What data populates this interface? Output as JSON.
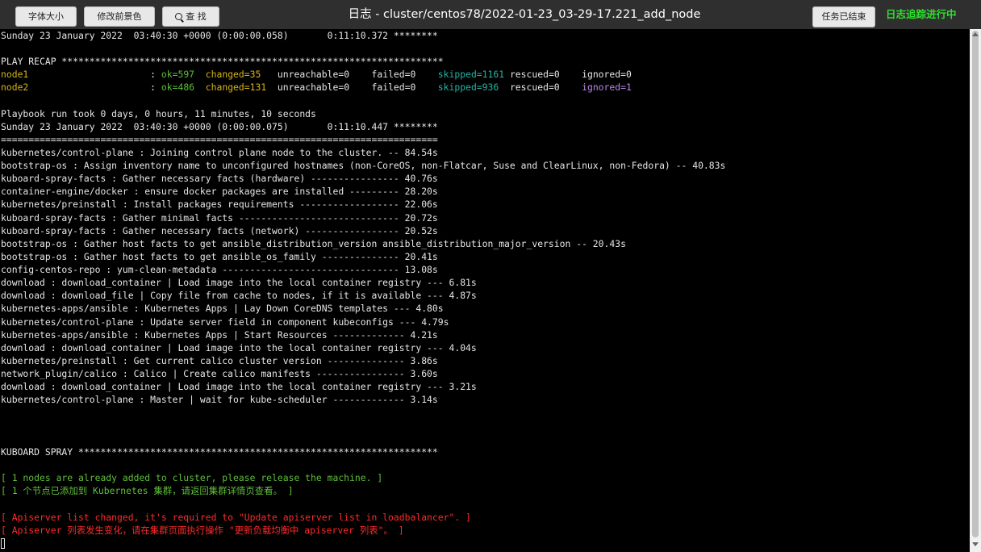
{
  "header": {
    "font_size_label": "字体大小",
    "bg_color_label": "修改前景色",
    "search_label": "查 找",
    "title": "日志 - cluster/centos78/2022-01-23_03-29-17.221_add_node",
    "task_done_label": "任务已结束",
    "tracking_status": "日志追踪进行中"
  },
  "colors": {
    "header_bg": "#2f2f2f",
    "terminal_bg": "#000000",
    "text": "#e6e6e6",
    "ok_yellow": "#d8b417",
    "ok_green": "#5fbf3a",
    "skipped_cyan": "#24b3a6",
    "ignored_magenta": "#b986e6",
    "error_red": "#ff2a2a",
    "tracking_green": "#2fe02f"
  },
  "log": {
    "l01": "Sunday 23 January 2022  03:40:30 +0000 (0:00:00.058)       0:11:10.372 ********",
    "l02": "PLAY RECAP *********************************************************************",
    "recap": {
      "n1_host": "node1                      ",
      "n1_sep": ": ",
      "n1_ok": "ok=597",
      "n1_gap1": "  ",
      "n1_changed": "changed=35",
      "n1_mid": "   unreachable=0    failed=0    ",
      "n1_skipped": "skipped=1161",
      "n1_tail": " rescued=0    ignored=0",
      "n2_host": "node2                      ",
      "n2_sep": ": ",
      "n2_ok": "ok=486",
      "n2_gap1": "  ",
      "n2_changed": "changed=131",
      "n2_mid": "  unreachable=0    failed=0    ",
      "n2_skipped": "skipped=936",
      "n2_gap2": "  rescued=0    ",
      "n2_ignored": "ignored=1"
    },
    "l03": "Playbook run took 0 days, 0 hours, 11 minutes, 10 seconds",
    "l04": "Sunday 23 January 2022  03:40:30 +0000 (0:00:00.075)       0:11:10.447 ********",
    "l05": "===============================================================================",
    "l06": "kubernetes/control-plane : Joining control plane node to the cluster. -- 84.54s",
    "l07": "bootstrap-os : Assign inventory name to unconfigured hostnames (non-CoreOS, non-Flatcar, Suse and ClearLinux, non-Fedora) -- 40.83s",
    "l08": "kuboard-spray-facts : Gather necessary facts (hardware) ---------------- 40.76s",
    "l09": "container-engine/docker : ensure docker packages are installed --------- 28.20s",
    "l10": "kubernetes/preinstall : Install packages requirements ------------------ 22.06s",
    "l11": "kuboard-spray-facts : Gather minimal facts ----------------------------- 20.72s",
    "l12": "kuboard-spray-facts : Gather necessary facts (network) ----------------- 20.52s",
    "l13": "bootstrap-os : Gather host facts to get ansible_distribution_version ansible_distribution_major_version -- 20.43s",
    "l14": "bootstrap-os : Gather host facts to get ansible_os_family -------------- 20.41s",
    "l15": "config-centos-repo : yum-clean-metadata -------------------------------- 13.08s",
    "l16": "download : download_container | Load image into the local container registry --- 6.81s",
    "l17": "download : download_file | Copy file from cache to nodes, if it is available --- 4.87s",
    "l18": "kubernetes-apps/ansible : Kubernetes Apps | Lay Down CoreDNS templates --- 4.80s",
    "l19": "kubernetes/control-plane : Update server field in component kubeconfigs --- 4.79s",
    "l20": "kubernetes-apps/ansible : Kubernetes Apps | Start Resources ------------- 4.21s",
    "l21": "download : download_container | Load image into the local container registry --- 4.04s",
    "l22": "kubernetes/preinstall : Get current calico cluster version -------------- 3.86s",
    "l23": "network_plugin/calico : Calico | Create calico manifests ---------------- 3.60s",
    "l24": "download : download_container | Load image into the local container registry --- 3.21s",
    "l25": "kubernetes/control-plane : Master | wait for kube-scheduler ------------- 3.14s",
    "l26": "KUBOARD SPRAY *****************************************************************",
    "l27": "[ 1 nodes are already added to cluster, please release the machine. ]",
    "l28": "[ 1 个节点已添加到 Kubernetes 集群，请返回集群详情页查看。 ]",
    "l29": "[ Apiserver list changed, it's required to \"Update apiserver list in loadbalancer\". ]",
    "l30": "[ Apiserver 列表发生变化，请在集群页面执行操作 \"更新负载均衡中 apiserver 列表\"。 ]"
  }
}
